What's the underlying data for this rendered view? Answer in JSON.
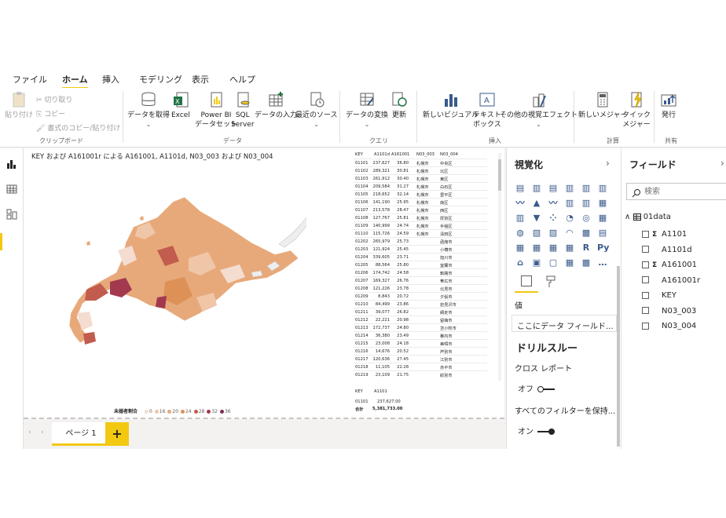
{
  "ribbon_tabs": [
    "ファイル",
    "ホーム",
    "挿入",
    "モデリング",
    "表示",
    "ヘルプ"
  ],
  "clipboard": {
    "paste": "貼り付け",
    "cut": "切り取り",
    "copy": "コピー",
    "format_painter": "書式のコピー/貼り付け",
    "group": "クリップボード"
  },
  "data_group": {
    "get_data": "データを取得",
    "excel": "Excel",
    "pbi_dataset_1": "Power BI",
    "pbi_dataset_2": "データセット",
    "sql_1": "SQL",
    "sql_2": "Server",
    "enter_data": "データの入力",
    "recent_sources": "最近のソース",
    "group": "データ"
  },
  "query_group": {
    "transform": "データの変換",
    "refresh": "更新",
    "group": "クエリ"
  },
  "insert_group": {
    "new_visual": "新しいビジュアル",
    "textbox_1": "テキスト",
    "textbox_2": "ボックス",
    "more_visuals": "その他の視覚エフェクト",
    "group": "挿入"
  },
  "calc_group": {
    "new_measure": "新しいメジャー",
    "quick_measure_1": "クイック",
    "quick_measure_2": "メジャー",
    "group": "計算"
  },
  "share_group": {
    "publish": "発行",
    "group": "共有"
  },
  "map": {
    "title": "KEY および A161001r による A161001, A1101d, N03_003 および N03_004",
    "legend_title": "未婚者割合",
    "legend_items": [
      "0",
      "16",
      "20",
      "24",
      "28",
      "32",
      "36"
    ],
    "legend_colors": [
      "#f4dcd0",
      "#f0c6a8",
      "#e8a97a",
      "#de9156",
      "#c25c4e",
      "#a2394f",
      "#7d2c55"
    ]
  },
  "table1": {
    "headers": [
      "KEY",
      "A1101d",
      "A161001",
      "N03_003",
      "N03_004"
    ],
    "rows": [
      [
        "01101",
        "237,627",
        "36.80",
        "札幌市",
        "中央区"
      ],
      [
        "01102",
        "289,321",
        "30.81",
        "札幌市",
        "北区"
      ],
      [
        "01103",
        "261,912",
        "30.40",
        "札幌市",
        "東区"
      ],
      [
        "01104",
        "209,584",
        "31.27",
        "札幌市",
        "白石区"
      ],
      [
        "01105",
        "218,652",
        "32.14",
        "札幌市",
        "豊平区"
      ],
      [
        "01106",
        "141,190",
        "25.95",
        "札幌市",
        "南区"
      ],
      [
        "01107",
        "213,578",
        "28.47",
        "札幌市",
        "西区"
      ],
      [
        "01108",
        "127,767",
        "25.81",
        "札幌市",
        "厚別区"
      ],
      [
        "01109",
        "140,999",
        "24.74",
        "札幌市",
        "手稲区"
      ],
      [
        "01110",
        "115,726",
        "24.59",
        "札幌市",
        "清田区"
      ],
      [
        "01202",
        "265,979",
        "25.73",
        "",
        "函館市"
      ],
      [
        "01203",
        "121,924",
        "25.45",
        "",
        "小樽市"
      ],
      [
        "01204",
        "339,605",
        "23.71",
        "",
        "旭川市"
      ],
      [
        "01205",
        "88,564",
        "25.80",
        "",
        "室蘭市"
      ],
      [
        "01206",
        "174,742",
        "24.58",
        "",
        "釧路市"
      ],
      [
        "01207",
        "169,327",
        "26.76",
        "",
        "帯広市"
      ],
      [
        "01208",
        "121,226",
        "23.78",
        "",
        "北見市"
      ],
      [
        "01209",
        "8,843",
        "20.72",
        "",
        "夕張市"
      ],
      [
        "01210",
        "84,499",
        "23.86",
        "",
        "岩見沢市"
      ],
      [
        "01211",
        "39,077",
        "26.82",
        "",
        "網走市"
      ],
      [
        "01212",
        "22,221",
        "20.98",
        "",
        "留萌市"
      ],
      [
        "01213",
        "172,737",
        "24.80",
        "",
        "苫小牧市"
      ],
      [
        "01214",
        "36,380",
        "23.49",
        "",
        "稚内市"
      ],
      [
        "01215",
        "23,008",
        "24.18",
        "",
        "美唄市"
      ],
      [
        "01216",
        "14,676",
        "20.52",
        "",
        "芦別市"
      ],
      [
        "01217",
        "120,636",
        "27.45",
        "",
        "江別市"
      ],
      [
        "01218",
        "11,105",
        "22.28",
        "",
        "赤平市"
      ],
      [
        "01219",
        "23,109",
        "21.75",
        "",
        "紋別市"
      ]
    ]
  },
  "table2": {
    "headers": [
      "KEY",
      "A1101"
    ],
    "row": [
      "01101",
      "237,627.00"
    ],
    "total_label": "合計",
    "total_value": "5,381,733.00"
  },
  "pages": {
    "page1": "ページ 1",
    "add": "+"
  },
  "viz_pane": {
    "title": "視覚化",
    "values_label": "値",
    "values_placeholder": "ここにデータ フィールド...",
    "drillthrough": "ドリルスルー",
    "cross_report": "クロス レポート",
    "cross_report_state": "オフ",
    "keep_filters": "すべてのフィルターを保持...",
    "keep_filters_state": "オン"
  },
  "fields_pane": {
    "title": "フィールド",
    "search_placeholder": "検索",
    "table_name": "01data",
    "fields": [
      {
        "name": "A1101",
        "sigma": true
      },
      {
        "name": "A1101d",
        "sigma": false
      },
      {
        "name": "A161001",
        "sigma": true
      },
      {
        "name": "A161001r",
        "sigma": false
      },
      {
        "name": "KEY",
        "sigma": false
      },
      {
        "name": "N03_003",
        "sigma": false
      },
      {
        "name": "N03_004",
        "sigma": false
      }
    ]
  }
}
